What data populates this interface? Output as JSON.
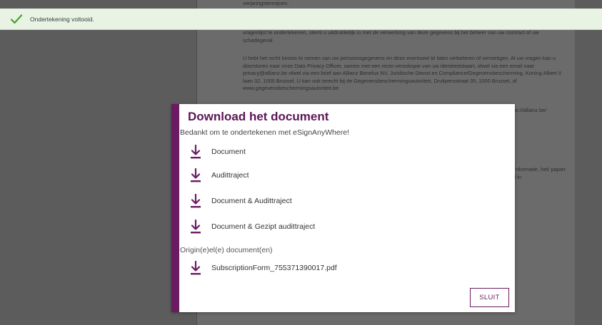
{
  "background_document": {
    "paragraphs": [
      "verjaringstermijnen.",
      "vragenlijst te ondertekenen, stemt u uitdrukkelijk in met de verwerking van deze gegevens bij het beheer van uw contract of uw schadegeval.",
      "U hebt het recht kennis te nemen van uw persoonsgegevens en deze eventueel te laten verbeteren of vernietigen. Al uw vragen kan u doorsturen naar onze Data Privacy Officer, samen met een recto-versokopie van uw identiteitskaart, ofwel via een email naar privacy@allianz.be ofwel via een brief aan Allianz Benelux NV, Juridische Dienst en Compliance/Gegevensbescherming, Koning Albert II laan 32, 1000 Brussel. U kan ook terecht bij de Gegevensbeschermingsautoriteit, Drukpersstraat 35, 1000 Brussel, of www.gegevensbeschermingsautoriteit.be",
      "tps://allianz.be/",
      "s",
      "e nformatie, het/ papier of in"
    ]
  },
  "toast": {
    "icon": "check-icon",
    "color": "#4aa02c",
    "message": "Ondertekening voltooid."
  },
  "modal": {
    "accent_color": "#6a1b63",
    "title": "Download het document",
    "subtitle": "Bedankt om te ondertekenen met eSignAnyWhere!",
    "downloads": [
      {
        "label": "Document",
        "icon": "download-icon"
      },
      {
        "label": "Audittraject",
        "icon": "download-icon"
      },
      {
        "label": "Document & Audittraject",
        "icon": "download-icon"
      },
      {
        "label": "Document & Gezipt audittraject",
        "icon": "download-icon"
      }
    ],
    "originals_label": "Origin(e)el(e) document(en)",
    "originals": [
      {
        "label": "SubscriptionForm_755371390017.pdf",
        "icon": "download-icon"
      }
    ],
    "close_label": "SLUIT"
  }
}
